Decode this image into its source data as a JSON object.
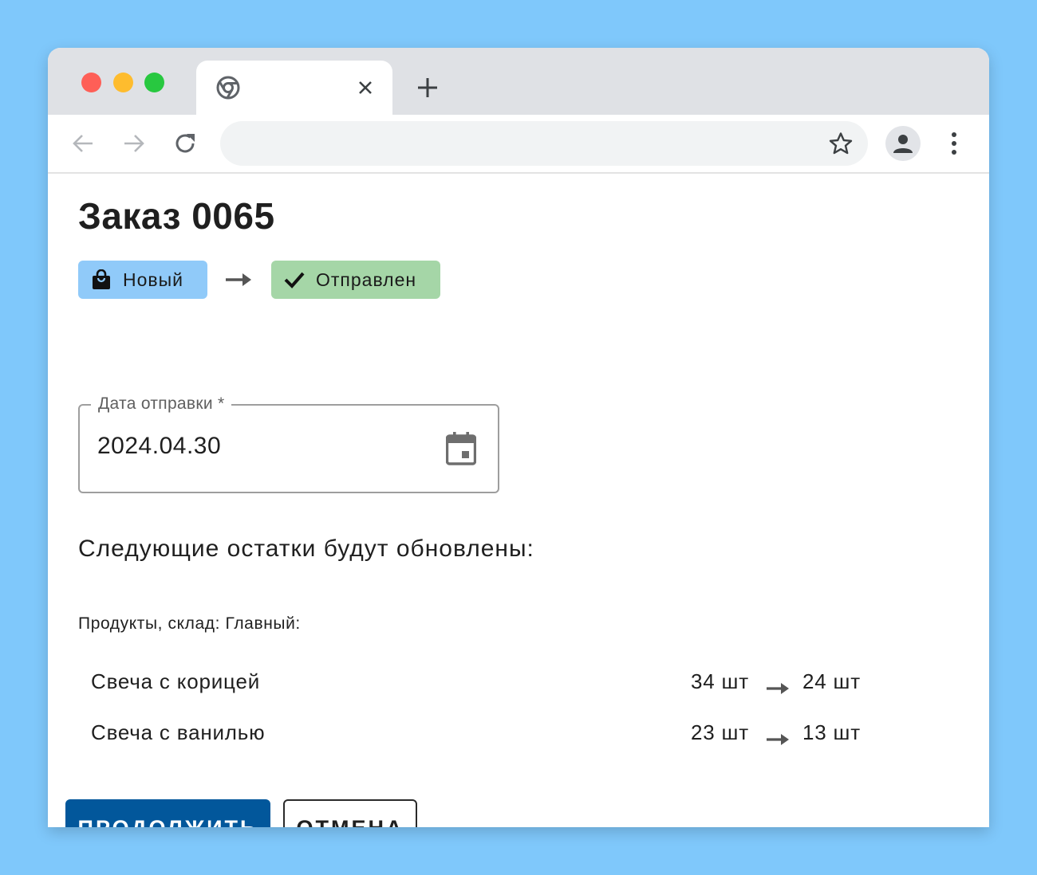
{
  "browser": {
    "tab_title": "",
    "address": ""
  },
  "order": {
    "title": "Заказ 0065",
    "status_from": "Новый",
    "status_to": "Отправлен"
  },
  "date_field": {
    "label": "Дата отправки *",
    "value": "2024.04.30"
  },
  "stock": {
    "heading": "Следующие остатки будут обновлены:",
    "warehouse_label": "Продукты, склад: Главный:",
    "items": [
      {
        "name": "Свеча с корицей",
        "from": "34 шт",
        "to": "24 шт"
      },
      {
        "name": "Свеча с ванилью",
        "from": "23 шт",
        "to": "13 шт"
      }
    ]
  },
  "actions": {
    "continue_label": "ПРОДОЛЖИТЬ",
    "cancel_label": "ОТМЕНА"
  },
  "colors": {
    "background": "#7fc8fb",
    "status_new": "#90caf9",
    "status_sent": "#a5d6a7",
    "primary": "#02579b"
  }
}
